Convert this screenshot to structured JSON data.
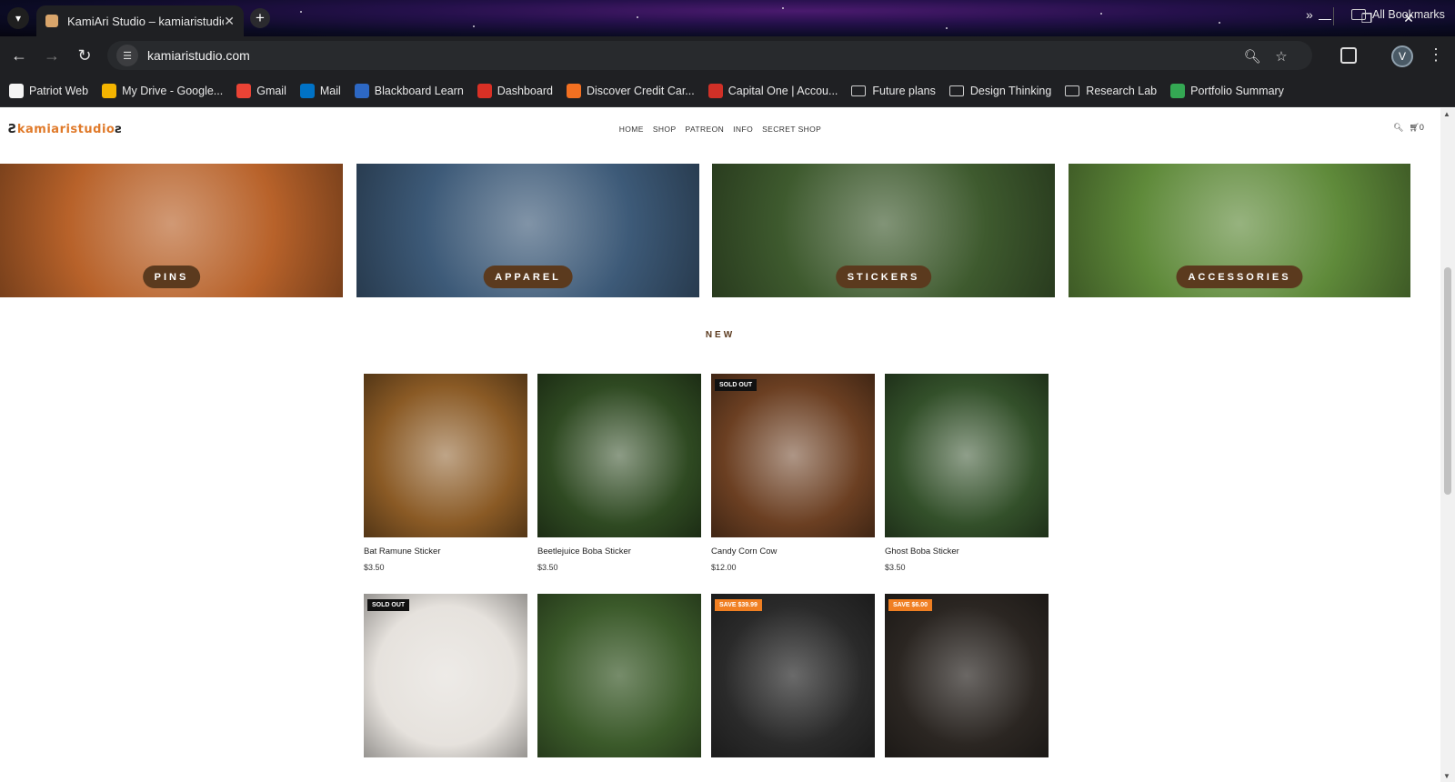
{
  "browser": {
    "tab_title": "KamiAri Studio – kamiaristudio",
    "close_glyph": "✕",
    "new_tab_glyph": "+",
    "url": "kamiaristudio.com",
    "profile_initial": "V",
    "window_controls": {
      "minimize": "—",
      "restore": "❐",
      "close": "✕"
    },
    "nav": {
      "back": "←",
      "forward": "→",
      "reload": "↻"
    },
    "bookmarks": [
      {
        "label": "Patriot Web",
        "icon_color": "#f4f4f4",
        "type": "site"
      },
      {
        "label": "My Drive - Google...",
        "icon_color": "#f4b400",
        "type": "site"
      },
      {
        "label": "Gmail",
        "icon_color": "#ea4335",
        "type": "site"
      },
      {
        "label": "Mail",
        "icon_color": "#0072c6",
        "type": "site"
      },
      {
        "label": "Blackboard Learn",
        "icon_color": "#2d68c4",
        "type": "site"
      },
      {
        "label": "Dashboard",
        "icon_color": "#d93025",
        "type": "site"
      },
      {
        "label": "Discover Credit Car...",
        "icon_color": "#f37021",
        "type": "site"
      },
      {
        "label": "Capital One | Accou...",
        "icon_color": "#d03027",
        "type": "site"
      },
      {
        "label": "Future plans",
        "type": "folder"
      },
      {
        "label": "Design Thinking",
        "type": "folder"
      },
      {
        "label": "Research Lab",
        "type": "folder"
      },
      {
        "label": "Portfolio Summary",
        "icon_color": "#34a853",
        "type": "site"
      }
    ],
    "bookmarks_more": "»",
    "all_bookmarks": "All Bookmarks"
  },
  "site": {
    "logo_text": "kamiaristudio",
    "nav": [
      "HOME",
      "SHOP",
      "PATREON",
      "INFO",
      "SECRET SHOP"
    ],
    "cart_count": "0",
    "categories": [
      {
        "label": "PINS",
        "bg": "#b8622a"
      },
      {
        "label": "APPAREL",
        "bg": "#3d5a78"
      },
      {
        "label": "STICKERS",
        "bg": "#3e5a2e"
      },
      {
        "label": "ACCESSORIES",
        "bg": "#5f8a3a"
      }
    ],
    "new_heading": "NEW",
    "products_row1": [
      {
        "name": "Bat Ramune Sticker",
        "price": "$3.50",
        "badge": "",
        "bg": "#8a5a25"
      },
      {
        "name": "Beetlejuice Boba Sticker",
        "price": "$3.50",
        "badge": "",
        "bg": "#2f4a22"
      },
      {
        "name": "Candy Corn Cow",
        "price": "$12.00",
        "badge": "SOLD OUT",
        "bg": "#6b3f22"
      },
      {
        "name": "Ghost Boba Sticker",
        "price": "$3.50",
        "badge": "",
        "bg": "#33502a"
      }
    ],
    "products_row2": [
      {
        "badge": "SOLD OUT",
        "badge_type": "sold",
        "bg": "#e6e2dd"
      },
      {
        "badge": "",
        "badge_type": "",
        "bg": "#3b5a2a"
      },
      {
        "badge": "SAVE $39.99",
        "badge_type": "sale",
        "bg": "#2a2a2a"
      },
      {
        "badge": "SAVE $6.00",
        "badge_type": "sale",
        "bg": "#2b2622"
      }
    ]
  }
}
